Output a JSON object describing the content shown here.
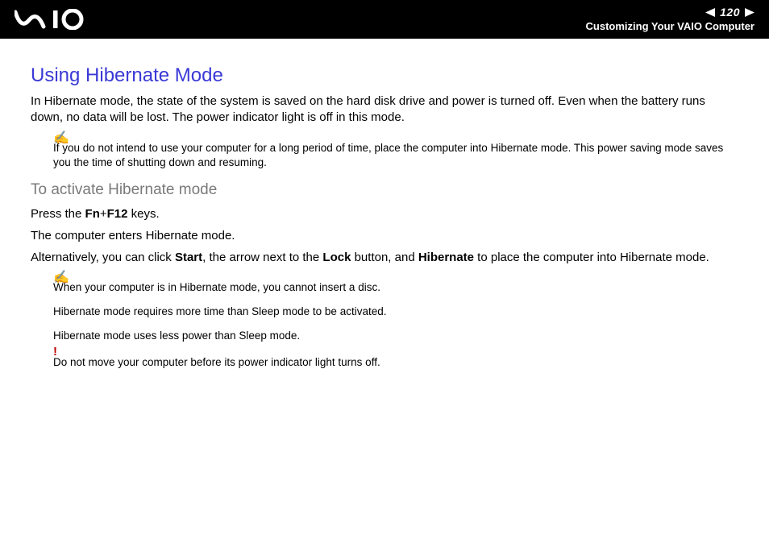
{
  "header": {
    "page_number": "120",
    "breadcrumb": "Customizing Your VAIO Computer"
  },
  "main": {
    "title": "Using Hibernate Mode",
    "intro": "In Hibernate mode, the state of the system is saved on the hard disk drive and power is turned off. Even when the battery runs down, no data will be lost. The power indicator light is off in this mode.",
    "note1": "If you do not intend to use your computer for a long period of time, place the computer into Hibernate mode. This power saving mode saves you the time of shutting down and resuming.",
    "subheading": "To activate Hibernate mode",
    "press_pre": "Press the ",
    "press_key": "Fn",
    "press_plus": "+",
    "press_key2": "F12",
    "press_post": " keys.",
    "enter_line": "The computer enters Hibernate mode.",
    "alt_pre": "Alternatively, you can click ",
    "alt_b1": "Start",
    "alt_mid1": ", the arrow next to the ",
    "alt_b2": "Lock",
    "alt_mid2": " button, and ",
    "alt_b3": "Hibernate",
    "alt_post": " to place the computer into Hibernate mode.",
    "note2a": "When your computer is in Hibernate mode, you cannot insert a disc.",
    "note2b": "Hibernate mode requires more time than Sleep mode to be activated.",
    "note2c": "Hibernate mode uses less power than Sleep mode.",
    "warn": "Do not move your computer before its power indicator light turns off."
  }
}
